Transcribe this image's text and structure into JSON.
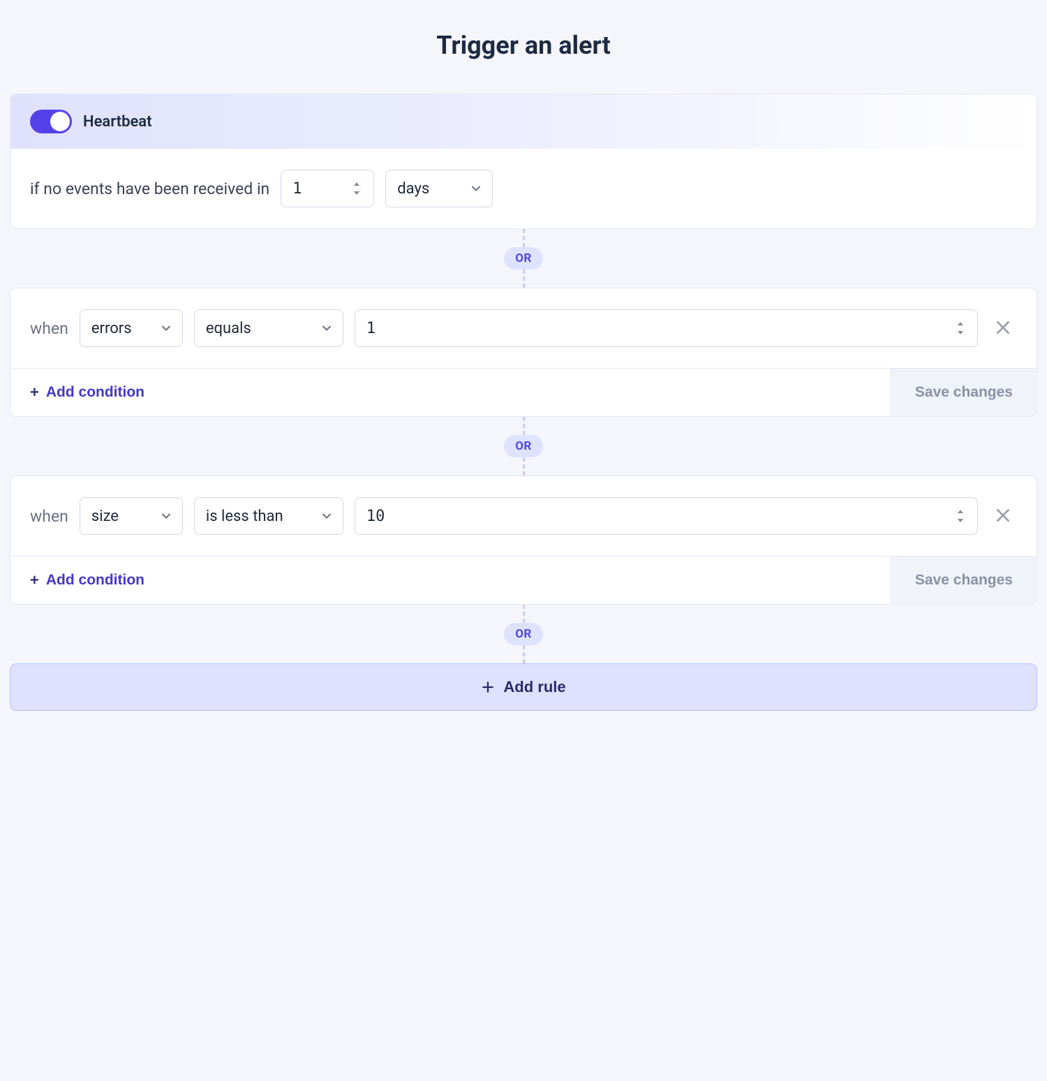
{
  "title": "Trigger an alert",
  "connector_label": "OR",
  "heartbeat": {
    "label": "Heartbeat",
    "description_prefix": "if no events have been received in",
    "count": "1",
    "unit": "days"
  },
  "rules": [
    {
      "prefix": "when",
      "field": "errors",
      "operator": "equals",
      "value": "1",
      "add_condition_label": "Add condition",
      "save_label": "Save changes"
    },
    {
      "prefix": "when",
      "field": "size",
      "operator": "is less than",
      "value": "10",
      "add_condition_label": "Add condition",
      "save_label": "Save changes"
    }
  ],
  "add_rule_label": "Add rule"
}
